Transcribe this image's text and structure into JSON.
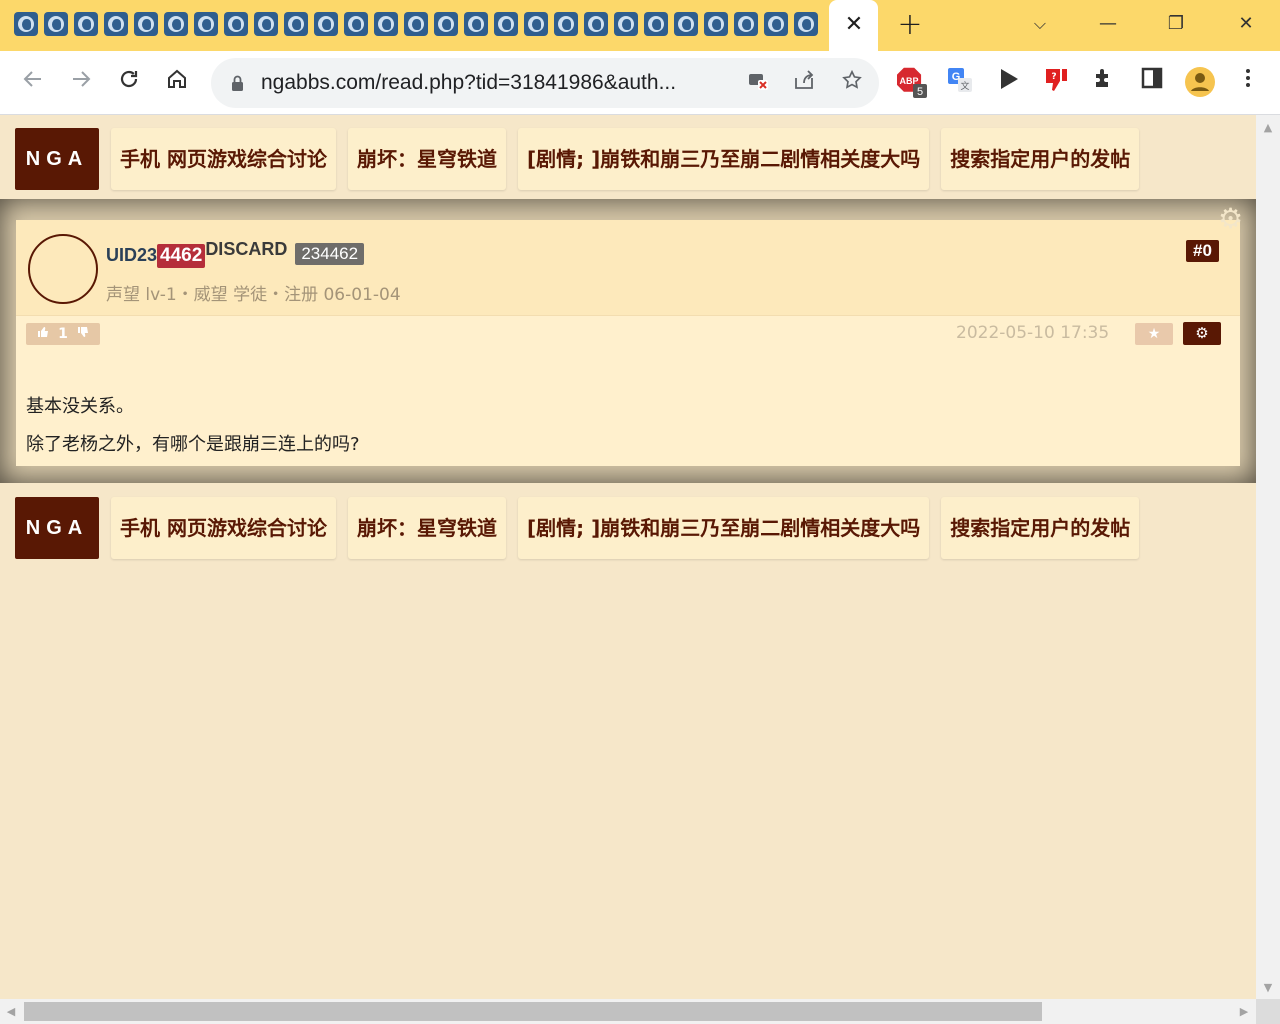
{
  "browser": {
    "favicon_count": 27,
    "tab_close": "✕",
    "new_tab": "+",
    "url": "ngabbs.com/read.php?tid=31841986&auth...",
    "window_controls": {
      "dropdown": "⌵",
      "minimize": "—",
      "restore": "❐",
      "close": "✕"
    },
    "extension_badge": "5",
    "adblock_label": "ABP",
    "icons": [
      "back-icon",
      "forward-icon",
      "reload-icon",
      "home-icon",
      "lock-icon",
      "camera-blocked-icon",
      "share-icon",
      "bookmark-star-icon",
      "adblock-icon",
      "translate-icon",
      "play-icon",
      "dislike-icon",
      "extensions-icon",
      "side-panel-icon",
      "profile-icon",
      "menu-icon"
    ]
  },
  "nav": {
    "logo": "NGA",
    "items": [
      "手机 网页游戏综合讨论",
      "崩坏：星穹铁道",
      "[剧情; ]崩铁和崩三乃至崩二剧情相关度大吗",
      "搜索指定用户的发帖"
    ]
  },
  "post": {
    "user": {
      "uid_prefix": "UID23",
      "uid_highlight": "4462",
      "uid_suffix": "DISCARD",
      "uid_badge": "234462",
      "meta": "声望 lv-1・威望 学徒・注册 06-01-04"
    },
    "floor": "#0",
    "votes": "1",
    "time": "2022-05-10 17:35",
    "content": [
      "基本没关系。",
      "除了老杨之外，有哪个是跟崩三连上的吗?"
    ]
  },
  "colors": {
    "page_bg": "#f6e7c9",
    "brand": "#591804",
    "tabstrip": "#fcd86a",
    "uid_highlight": "#b52e3a"
  }
}
